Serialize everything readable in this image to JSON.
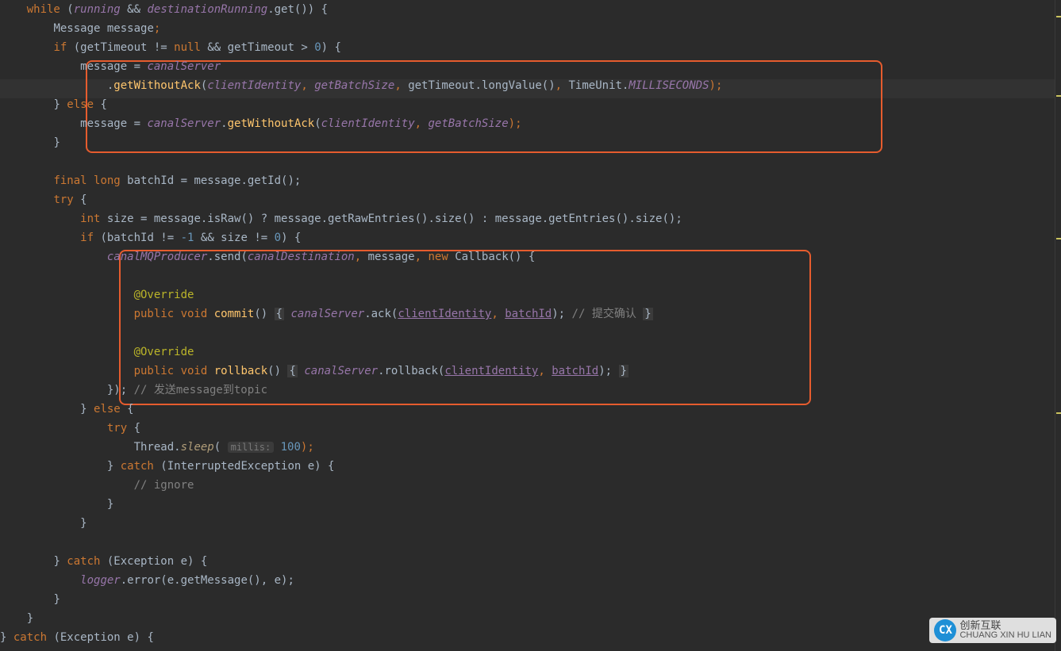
{
  "code": {
    "l01_a": "while",
    "l01_b": " (",
    "l01_c": "running",
    "l01_d": " && ",
    "l01_e": "destinationRunning",
    "l01_f": ".get()) {",
    "l02_a": "Message ",
    "l02_b": "message",
    "l02_c": ";",
    "l03_a": "if ",
    "l03_b": "(getTimeout != ",
    "l03_c": "null",
    "l03_d": " && getTimeout > ",
    "l03_e": "0",
    "l03_f": ") {",
    "l04_a": "message ",
    "l04_b": "= ",
    "l04_c": "canalServer",
    "l05_a": ".",
    "l05_b": "getWithoutAck",
    "l05_c": "(",
    "l05_d": "clientIdentity",
    "l05_e": ", ",
    "l05_f": "getBatchSize",
    "l05_g": ", ",
    "l05_h": "getTimeout.longValue()",
    "l05_i": ", ",
    "l05_j": "TimeUnit.",
    "l05_k": "MILLISECONDS",
    "l05_l": ");",
    "l06_a": "} ",
    "l06_b": "else",
    "l06_c": " {",
    "l07_a": "message ",
    "l07_b": "= ",
    "l07_c": "canalServer",
    "l07_d": ".",
    "l07_e": "getWithoutAck",
    "l07_f": "(",
    "l07_g": "clientIdentity",
    "l07_h": ", ",
    "l07_i": "getBatchSize",
    "l07_j": ");",
    "l08_a": "}",
    "l09_a": "final long ",
    "l09_b": "batchId = message.getId();",
    "l10_a": "try ",
    "l10_b": "{",
    "l11_a": "int ",
    "l11_b": "size = message.isRaw() ? message.getRawEntries().size() : message.getEntries().size();",
    "l12_a": "if ",
    "l12_b": "(batchId != ",
    "l12_c": "-1",
    "l12_d": " && size != ",
    "l12_e": "0",
    "l12_f": ") {",
    "l13_a": "canalMQProducer",
    "l13_b": ".send(",
    "l13_c": "canalDestination",
    "l13_d": ", ",
    "l13_e": "message",
    "l13_f": ", ",
    "l13_g": "new ",
    "l13_h": "Callback() {",
    "l14_a": "@Override",
    "l15_a": "public void ",
    "l15_b": "commit",
    "l15_c": "() ",
    "l15_d": "{",
    "l15_e": " canalServer",
    "l15_f": ".ack(",
    "l15_g": "clientIdentity",
    "l15_h": ", ",
    "l15_i": "batchId",
    "l15_j": "); ",
    "l15_k": "// 提交确认 ",
    "l15_l": "}",
    "l16_a": "@Override",
    "l17_a": "public void ",
    "l17_b": "rollback",
    "l17_c": "() ",
    "l17_d": "{",
    "l17_e": " canalServer",
    "l17_f": ".rollback(",
    "l17_g": "clientIdentity",
    "l17_h": ", ",
    "l17_i": "batchId",
    "l17_j": "); ",
    "l17_k": "}",
    "l18_a": "}); ",
    "l18_b": "// 发送message到topic",
    "l19_a": "} ",
    "l19_b": "else ",
    "l19_c": "{",
    "l20_a": "try ",
    "l20_b": "{",
    "l21_a": "Thread.",
    "l21_b": "sleep",
    "l21_c": "( ",
    "l21_hint": "millis:",
    "l21_d": " 100",
    "l21_e": ");",
    "l22_a": "} ",
    "l22_b": "catch ",
    "l22_c": "(InterruptedException e) {",
    "l23_a": "// ignore",
    "l24_a": "}",
    "l25_a": "}",
    "l26_a": "} ",
    "l26_b": "catch ",
    "l26_c": "(Exception e) {",
    "l27_a": "logger",
    "l27_b": ".error(e.getMessage(), e);",
    "l28_a": "}",
    "l29_a": "}",
    "l30_a": "} ",
    "l30_b": "catch ",
    "l30_c": "(Exception e) {"
  },
  "watermark": {
    "logo": "CX",
    "line1": "CHUANG XIN HU LIAN",
    "line2": "创新互联"
  }
}
